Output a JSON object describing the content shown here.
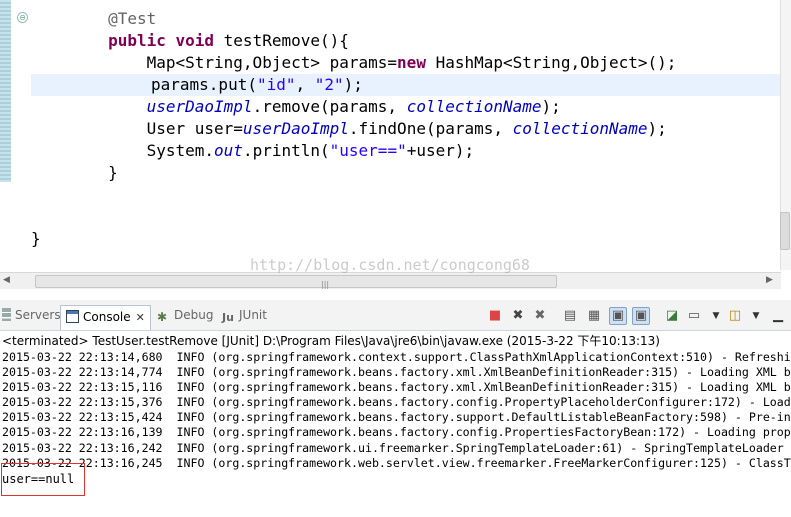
{
  "editor": {
    "lines": [
      {
        "indent": "        ",
        "parts": [
          {
            "t": "@Test",
            "c": "ann"
          }
        ]
      },
      {
        "indent": "        ",
        "parts": [
          {
            "t": "public",
            "c": "kw"
          },
          {
            "t": " ",
            "c": ""
          },
          {
            "t": "void",
            "c": "kw"
          },
          {
            "t": " testRemove(){",
            "c": ""
          }
        ]
      },
      {
        "indent": "            ",
        "parts": [
          {
            "t": "Map<String,Object> params=",
            "c": ""
          },
          {
            "t": "new",
            "c": "kw"
          },
          {
            "t": " HashMap<String,Object>();",
            "c": ""
          }
        ]
      },
      {
        "indent": "",
        "highlight": true,
        "parts": [
          {
            "t": "params.put(",
            "c": ""
          },
          {
            "t": "\"id\"",
            "c": "str"
          },
          {
            "t": ", ",
            "c": ""
          },
          {
            "t": "\"2\"",
            "c": "str"
          },
          {
            "t": ");",
            "c": ""
          }
        ]
      },
      {
        "indent": "            ",
        "parts": [
          {
            "t": "userDaoImpl",
            "c": "fld"
          },
          {
            "t": ".remove(params, ",
            "c": ""
          },
          {
            "t": "collectionName",
            "c": "fld"
          },
          {
            "t": ");",
            "c": ""
          }
        ]
      },
      {
        "indent": "            ",
        "parts": [
          {
            "t": "User user=",
            "c": ""
          },
          {
            "t": "userDaoImpl",
            "c": "fld"
          },
          {
            "t": ".findOne(params, ",
            "c": ""
          },
          {
            "t": "collectionName",
            "c": "fld"
          },
          {
            "t": ");",
            "c": ""
          }
        ]
      },
      {
        "indent": "            ",
        "parts": [
          {
            "t": "System.",
            "c": ""
          },
          {
            "t": "out",
            "c": "sfld"
          },
          {
            "t": ".println(",
            "c": ""
          },
          {
            "t": "\"user==\"",
            "c": "str"
          },
          {
            "t": "+user);",
            "c": ""
          }
        ]
      },
      {
        "indent": "        ",
        "parts": [
          {
            "t": "}",
            "c": ""
          }
        ]
      },
      {
        "indent": "",
        "parts": []
      },
      {
        "indent": "",
        "parts": []
      },
      {
        "indent": "",
        "parts": [
          {
            "t": "}",
            "c": ""
          }
        ]
      }
    ],
    "watermark": "http://blog.csdn.net/congcong68"
  },
  "console": {
    "tabs": {
      "servers": "Servers",
      "console": "Console",
      "debug": "Debug",
      "junit": "JUnit"
    },
    "status": "<terminated> TestUser.testRemove [JUnit] D:\\Program Files\\Java\\jre6\\bin\\javaw.exe (2015-3-22 下午10:13:13)",
    "log": [
      "2015-03-22 22:13:14,680  INFO (org.springframework.context.support.ClassPathXmlApplicationContext:510) - Refreshi",
      "2015-03-22 22:13:14,774  INFO (org.springframework.beans.factory.xml.XmlBeanDefinitionReader:315) - Loading XML b",
      "2015-03-22 22:13:15,116  INFO (org.springframework.beans.factory.xml.XmlBeanDefinitionReader:315) - Loading XML b",
      "2015-03-22 22:13:15,376  INFO (org.springframework.beans.factory.config.PropertyPlaceholderConfigurer:172) - Load",
      "2015-03-22 22:13:15,424  INFO (org.springframework.beans.factory.support.DefaultListableBeanFactory:598) - Pre-in",
      "2015-03-22 22:13:16,139  INFO (org.springframework.beans.factory.config.PropertiesFactoryBean:172) - Loading prop",
      "2015-03-22 22:13:16,242  INFO (org.springframework.ui.freemarker.SpringTemplateLoader:61) - SpringTemplateLoader ",
      "2015-03-22 22:13:16,245  INFO (org.springframework.web.servlet.view.freemarker.FreeMarkerConfigurer:125) - ClassT"
    ],
    "result": "user==null"
  }
}
